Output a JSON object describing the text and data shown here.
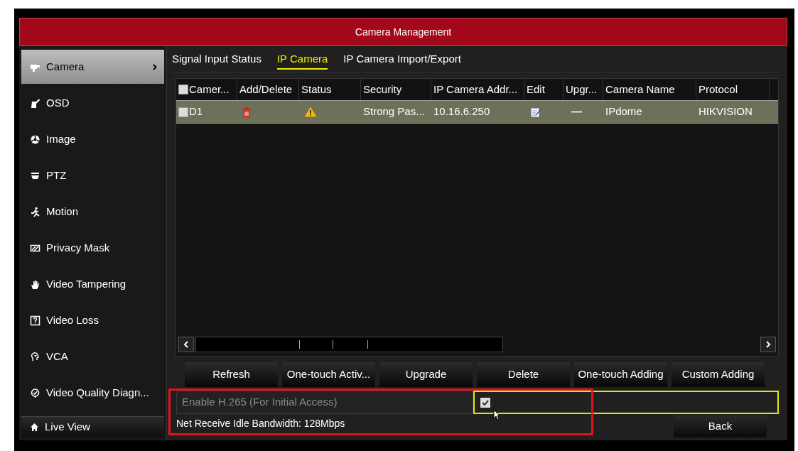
{
  "window": {
    "title": "Camera Management"
  },
  "sidebar": {
    "items": [
      {
        "label": "Camera",
        "selected": true
      },
      {
        "label": "OSD",
        "selected": false
      },
      {
        "label": "Image",
        "selected": false
      },
      {
        "label": "PTZ",
        "selected": false
      },
      {
        "label": "Motion",
        "selected": false
      },
      {
        "label": "Privacy Mask",
        "selected": false
      },
      {
        "label": "Video Tampering",
        "selected": false
      },
      {
        "label": "Video Loss",
        "selected": false
      },
      {
        "label": "VCA",
        "selected": false
      },
      {
        "label": "Video Quality Diagn...",
        "selected": false
      }
    ],
    "live_view": "Live View"
  },
  "tabs": [
    {
      "label": "Signal Input Status",
      "selected": false
    },
    {
      "label": "IP Camera",
      "selected": true
    },
    {
      "label": "IP Camera Import/Export",
      "selected": false
    }
  ],
  "table": {
    "select_all_checked": false,
    "columns": [
      "Camer...",
      "Add/Delete",
      "Status",
      "Security",
      "IP Camera Addr...",
      "Edit",
      "Upgr...",
      "Camera Name",
      "Protocol"
    ],
    "rows": [
      {
        "checked": false,
        "selected": true,
        "camera": "D1",
        "security": "Strong Pas...",
        "address": "10.16.6.250",
        "upgrade": "—",
        "name": "IPdome",
        "protocol": "HIKVISION"
      }
    ]
  },
  "buttons": [
    "Refresh",
    "One-touch Activ...",
    "Upgrade",
    "Delete",
    "One-touch Adding",
    "Custom Adding"
  ],
  "h265": {
    "label": "Enable H.265 (For Initial Access)",
    "checked": true
  },
  "bandwidth": "Net Receive Idle Bandwidth: 128Mbps",
  "back_button": "Back"
}
